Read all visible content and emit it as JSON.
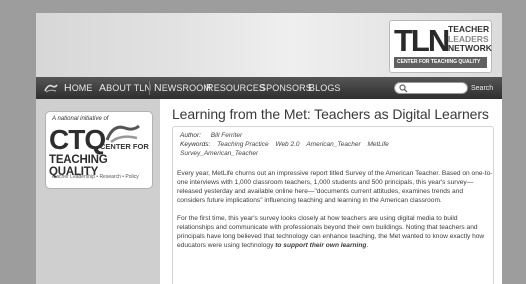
{
  "site": {
    "logo_letters": "TLN",
    "logo_words": [
      "TEACHER",
      "LEADERS",
      "NETWORK"
    ],
    "logo_bar": "CENTER FOR TEACHING QUALITY"
  },
  "nav": {
    "items": [
      "Home",
      "About TLN",
      "Newsroom",
      "Resources",
      "Sponsors",
      "Blogs"
    ],
    "search_placeholder": "",
    "search_label": "Search"
  },
  "sidebar": {
    "initiative": "A national initiative of",
    "ctq_letters": "CTQ",
    "ctq_center": "CENTER FOR",
    "ctq_tq": "TEACHING QUALITY",
    "ctq_tagline": "Teacher Leadership • Research • Policy"
  },
  "post": {
    "title": "Learning from the Met: Teachers as Digital Learners",
    "author_label": "Author:",
    "author": "Bill Ferriter",
    "keywords_label": "Keywords:",
    "keywords": [
      "Teaching Practice",
      "Web 2.0",
      "American_Teacher",
      "MetLife",
      "Survey_American_Teacher"
    ],
    "para1": "Every year, MetLife churns out an impressive report titled Survey of the American Teacher.  Based on one-to-one interviews with 1,000 classroom teachers, 1,000 students and 500 principals, this year's survey—released yesterday and available online here—\"documents current attitudes, examines trends and considers future implications\" influencing teaching and learning in the American classroom.",
    "para2_start": "For the first time, this year's survey looks closely at how teachers are using digital media to build relationships and communicate with professionals beyond their own buildings.  Noting that teachers and principals have long believed that technology can enhance teaching, the Met wanted to know exactly how educators were using technology ",
    "para2_emph": "to support their own learning",
    "para2_end": "."
  }
}
